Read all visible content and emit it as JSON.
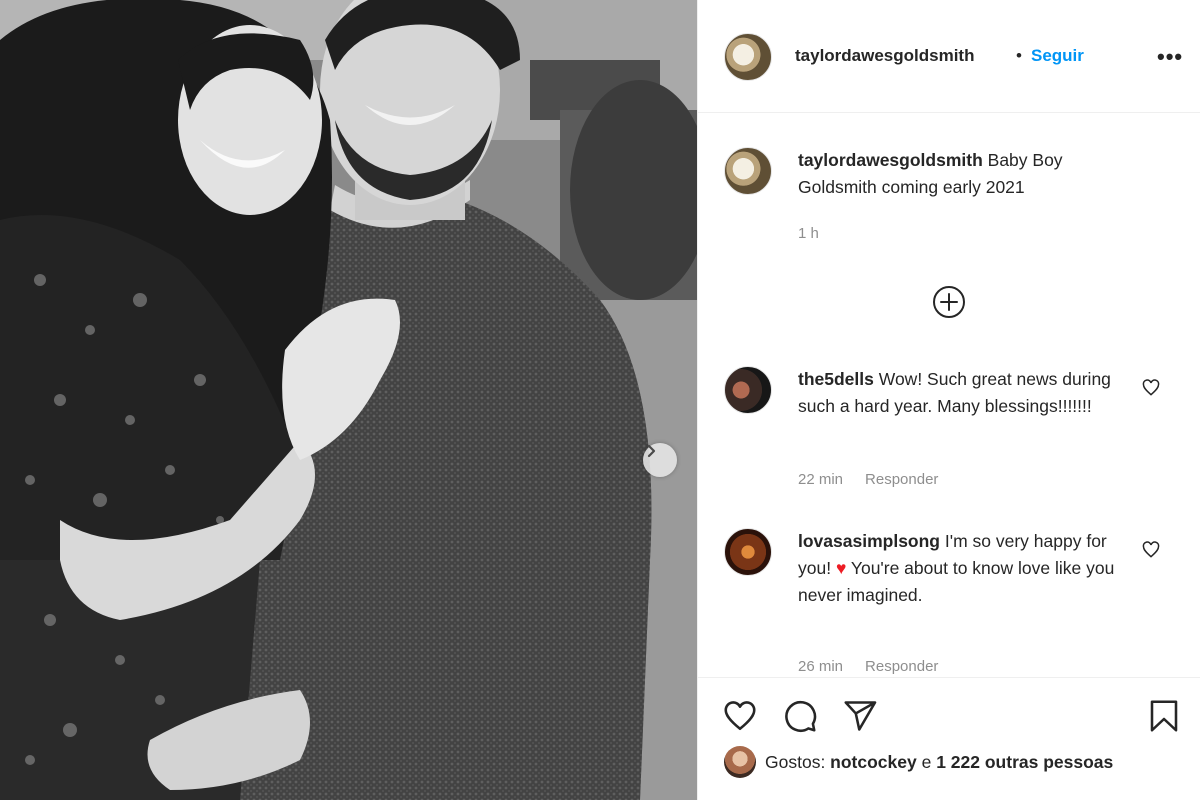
{
  "post": {
    "author": "taylordawesgoldsmith",
    "separator": "•",
    "follow_label": "Seguir",
    "more_label": "•••",
    "image_alt": "Black and white photo of a smiling couple embracing"
  },
  "caption": {
    "username": "taylordawesgoldsmith",
    "text": "Baby Boy Goldsmith coming early 2021",
    "time": "1 h"
  },
  "comments": [
    {
      "username": "the5dells",
      "text": "Wow! Such great news during such a hard year. Many blessings!!!!!!!",
      "time": "22 min",
      "reply_label": "Responder"
    },
    {
      "username": "lovasasimplsong",
      "text_before": "I'm so very happy for you! ",
      "emoji": "♥",
      "text_after": " You're about to know love like you never imagined.",
      "time": "26 min",
      "reply_label": "Responder"
    }
  ],
  "likes": {
    "prefix": "Gostos: ",
    "user": "notcockey",
    "connector": " e ",
    "others": "1 222 outras pessoas"
  },
  "date_partial": "      ",
  "colors": {
    "link": "#0095f6",
    "text": "#262626",
    "muted": "#8e8e8e",
    "heart": "#ed1c24"
  },
  "icons": [
    "chevron-right-icon",
    "plus-circle-icon",
    "heart-icon",
    "comment-icon",
    "share-icon",
    "bookmark-icon"
  ]
}
